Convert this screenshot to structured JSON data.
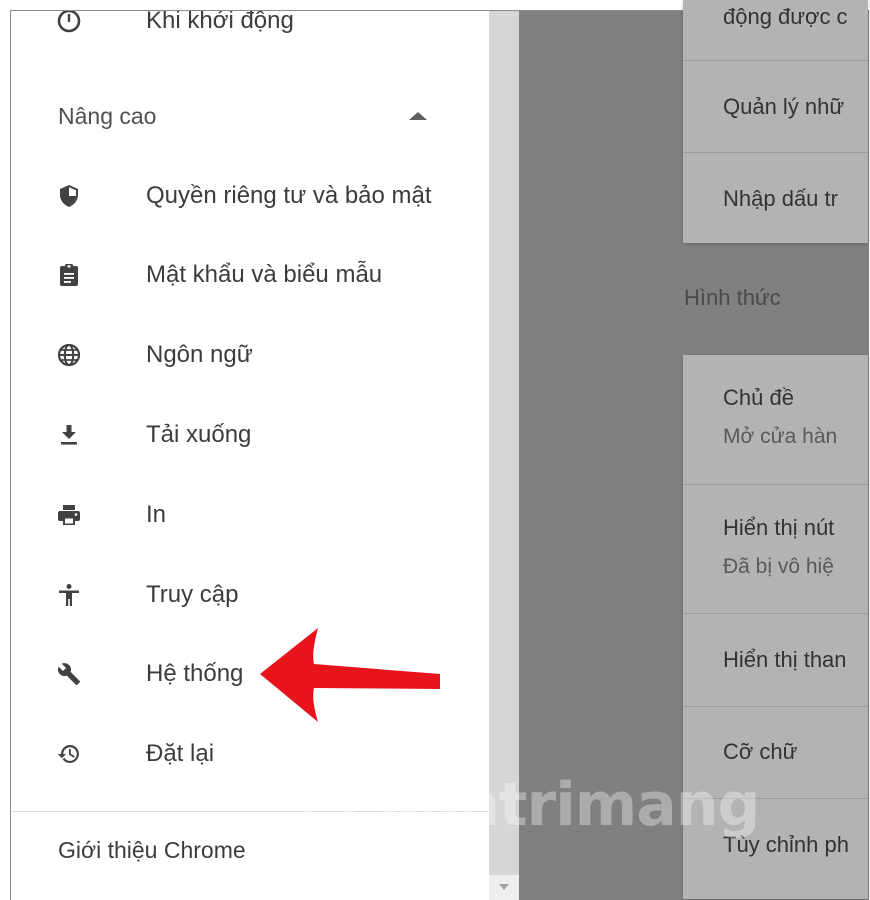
{
  "sidebar": {
    "top_item": {
      "label": "Khi khởi động",
      "icon": "power-icon"
    },
    "advanced": {
      "label": "Nâng cao",
      "icon": "caret-up-icon"
    },
    "items": [
      {
        "label": "Quyền riêng tư và bảo mật",
        "icon": "shield-icon"
      },
      {
        "label": "Mật khẩu và biểu mẫu",
        "icon": "clipboard-icon"
      },
      {
        "label": "Ngôn ngữ",
        "icon": "globe-icon"
      },
      {
        "label": "Tải xuống",
        "icon": "download-icon"
      },
      {
        "label": "In",
        "icon": "printer-icon"
      },
      {
        "label": "Truy cập",
        "icon": "accessibility-icon"
      },
      {
        "label": "Hệ thống",
        "icon": "wrench-icon"
      },
      {
        "label": "Đặt lại",
        "icon": "restore-icon"
      }
    ],
    "about": "Giới thiệu Chrome"
  },
  "main": {
    "startup_rows": [
      "động được c",
      "Quản lý nhữ",
      "Nhập dấu tr"
    ],
    "appearance_heading": "Hình thức",
    "appearance_rows": [
      {
        "title": "Chủ đề",
        "sub": "Mở cửa hàn"
      },
      {
        "title": "Hiển thị nút",
        "sub": "Đã bị vô hiệ"
      },
      {
        "title": "Hiển thị than"
      },
      {
        "title": "Cỡ chữ"
      },
      {
        "title": "Tùy chỉnh ph"
      }
    ]
  },
  "watermark": {
    "text": "uantrimang"
  },
  "colors": {
    "overlay": "#808080",
    "arrow": "#e8141b",
    "icon": "#424242"
  }
}
